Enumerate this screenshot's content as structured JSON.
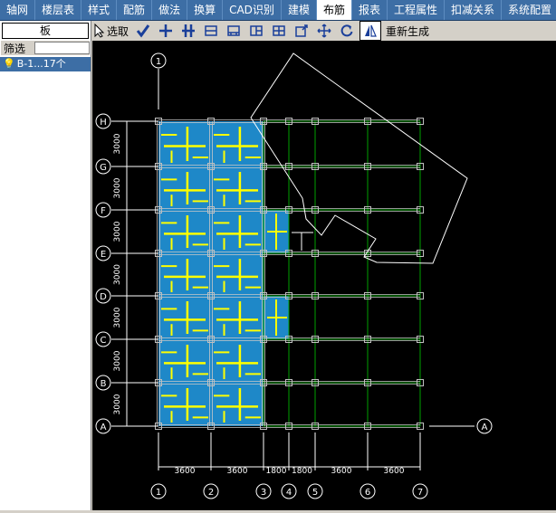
{
  "menu": {
    "tabs": [
      {
        "label": "轴网"
      },
      {
        "label": "楼层表"
      },
      {
        "label": "样式"
      },
      {
        "label": "配筋"
      },
      {
        "label": "做法"
      },
      {
        "label": "换算"
      },
      {
        "label": "CAD识别"
      },
      {
        "label": "建模"
      },
      {
        "label": "布筋"
      },
      {
        "label": "报表"
      },
      {
        "label": "工程属性"
      },
      {
        "label": "扣减关系"
      },
      {
        "label": "系统配置"
      }
    ],
    "active_index": 8
  },
  "left_panel": {
    "title": "板",
    "filter_label": "筛选",
    "filter_value": "",
    "tree_item_label": "B-1...17个"
  },
  "toolbar": {
    "select_label": "选取",
    "regenerate_label": "重新生成",
    "icons": [
      "pointer-icon",
      "check-icon",
      "cross-icon",
      "double-cross-icon",
      "rect-split-icon",
      "rect-join-icon",
      "rect-right-icon",
      "rect-grid-icon",
      "rect-corner-icon",
      "move-icon",
      "rotate-icon",
      "mirror-icon"
    ]
  },
  "drawing": {
    "row_axes": [
      "H",
      "G",
      "F",
      "E",
      "D",
      "C",
      "B",
      "A"
    ],
    "col_axes": [
      "1",
      "2",
      "3",
      "4",
      "5",
      "6",
      "7"
    ],
    "row_spacing_labels": [
      "3000",
      "3000",
      "3000",
      "3000",
      "3000",
      "3000",
      "3000"
    ],
    "col_spacing_labels": [
      "3600",
      "3600",
      "1800",
      "1800",
      "3600",
      "3600"
    ],
    "right_axis_label": "A",
    "top_axis_label": "1",
    "colors": {
      "background": "#000000",
      "slab_fill": "#1e88c8",
      "rebar": "#ffff00",
      "grid": "#00a000",
      "axis": "#ffffff"
    }
  }
}
